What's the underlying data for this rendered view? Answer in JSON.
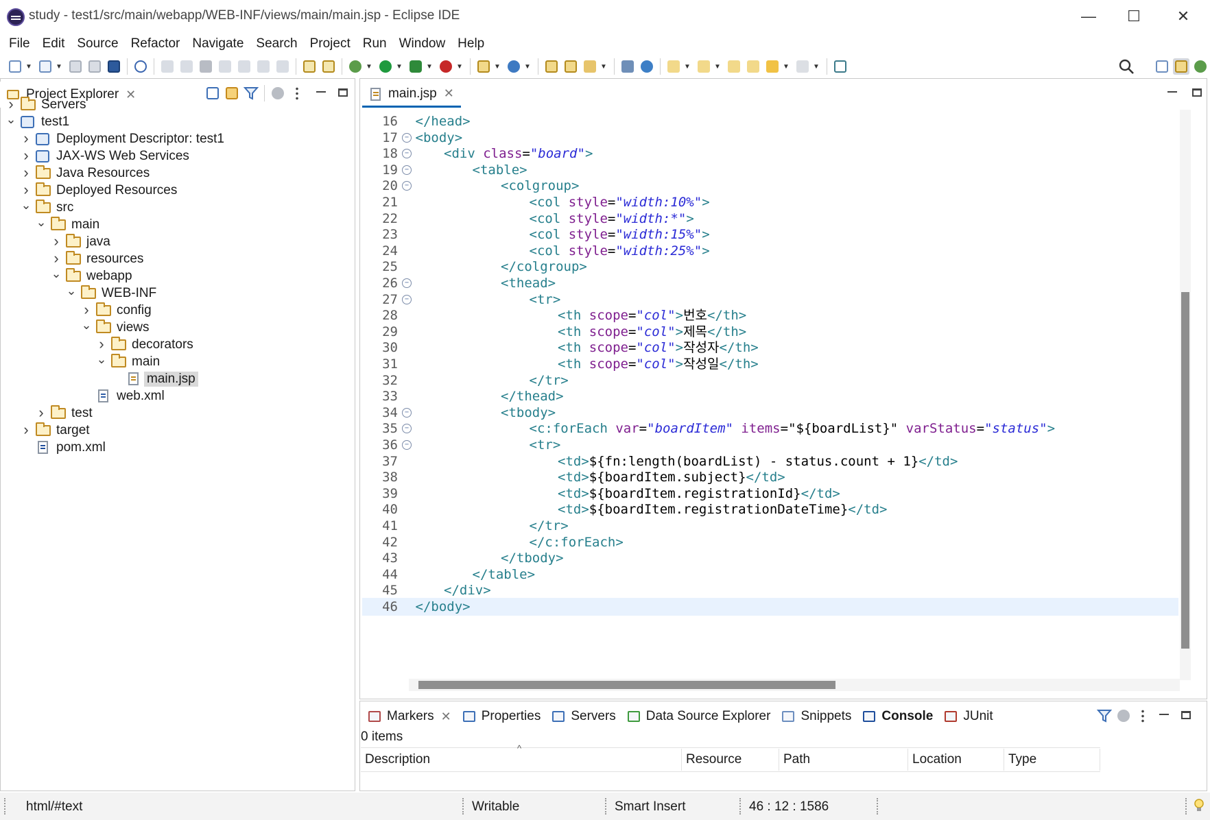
{
  "window": {
    "title": "study - test1/src/main/webapp/WEB-INF/views/main/main.jsp - Eclipse IDE",
    "minimize_glyph": "—",
    "maximize_glyph": "☐",
    "close_glyph": "✕"
  },
  "menu": [
    "File",
    "Edit",
    "Source",
    "Refactor",
    "Navigate",
    "Search",
    "Project",
    "Run",
    "Window",
    "Help"
  ],
  "colors": {
    "accent": "#0063b1",
    "tag": "#267f8c",
    "attribute": "#7f1f8f",
    "string": "#2a2ad6",
    "current_line": "#e8f2fe",
    "folder": "#c08a22"
  },
  "project_explorer": {
    "tab_label": "Project Explorer",
    "close_glyph": "✕",
    "tree": [
      {
        "label": "Servers",
        "depth": 0,
        "expanded": false,
        "icon": "servers-folder-icon"
      },
      {
        "label": "test1",
        "depth": 0,
        "expanded": true,
        "icon": "web-project-icon"
      },
      {
        "label": "Deployment Descriptor: test1",
        "depth": 1,
        "expanded": false,
        "icon": "deployment-descriptor-icon"
      },
      {
        "label": "JAX-WS Web Services",
        "depth": 1,
        "expanded": false,
        "icon": "web-services-icon"
      },
      {
        "label": "Java Resources",
        "depth": 1,
        "expanded": false,
        "icon": "java-resources-icon"
      },
      {
        "label": "Deployed Resources",
        "depth": 1,
        "expanded": false,
        "icon": "deployed-resources-icon"
      },
      {
        "label": "src",
        "depth": 1,
        "expanded": true,
        "icon": "folder-icon"
      },
      {
        "label": "main",
        "depth": 2,
        "expanded": true,
        "icon": "folder-icon"
      },
      {
        "label": "java",
        "depth": 3,
        "expanded": false,
        "icon": "folder-icon"
      },
      {
        "label": "resources",
        "depth": 3,
        "expanded": false,
        "icon": "folder-icon"
      },
      {
        "label": "webapp",
        "depth": 3,
        "expanded": true,
        "icon": "folder-icon"
      },
      {
        "label": "WEB-INF",
        "depth": 4,
        "expanded": true,
        "icon": "folder-icon"
      },
      {
        "label": "config",
        "depth": 5,
        "expanded": false,
        "icon": "folder-icon"
      },
      {
        "label": "views",
        "depth": 5,
        "expanded": true,
        "icon": "folder-icon"
      },
      {
        "label": "decorators",
        "depth": 6,
        "expanded": false,
        "icon": "folder-icon"
      },
      {
        "label": "main",
        "depth": 6,
        "expanded": true,
        "icon": "folder-icon"
      },
      {
        "label": "main.jsp",
        "depth": 7,
        "leaf": true,
        "selected": true,
        "icon": "jsp-file-icon"
      },
      {
        "label": "web.xml",
        "depth": 5,
        "leaf": true,
        "icon": "xml-file-icon"
      },
      {
        "label": "test",
        "depth": 2,
        "expanded": false,
        "icon": "folder-icon"
      },
      {
        "label": "target",
        "depth": 1,
        "expanded": false,
        "icon": "folder-icon"
      },
      {
        "label": "pom.xml",
        "depth": 1,
        "leaf": true,
        "icon": "maven-pom-icon"
      }
    ]
  },
  "editor": {
    "tab_label": "main.jsp",
    "close_glyph": "✕",
    "lines": [
      {
        "n": "16",
        "indent": 1,
        "fold": false,
        "tokens": [
          [
            "tag",
            "</head>"
          ]
        ]
      },
      {
        "n": "17",
        "indent": 1,
        "fold": true,
        "tokens": [
          [
            "tag",
            "<body>"
          ]
        ]
      },
      {
        "n": "18",
        "indent": 2,
        "fold": true,
        "tokens": [
          [
            "tag",
            "<div "
          ],
          [
            "attr",
            "class"
          ],
          [
            "txt",
            "="
          ],
          [
            "str",
            "\"board\""
          ],
          [
            "tag",
            ">"
          ]
        ]
      },
      {
        "n": "19",
        "indent": 3,
        "fold": true,
        "tokens": [
          [
            "tag",
            "<table>"
          ]
        ]
      },
      {
        "n": "20",
        "indent": 4,
        "fold": true,
        "tokens": [
          [
            "tag",
            "<colgroup>"
          ]
        ]
      },
      {
        "n": "21",
        "indent": 5,
        "fold": false,
        "tokens": [
          [
            "tag",
            "<col "
          ],
          [
            "attr",
            "style"
          ],
          [
            "txt",
            "="
          ],
          [
            "str",
            "\"width:10%\""
          ],
          [
            "tag",
            ">"
          ]
        ]
      },
      {
        "n": "22",
        "indent": 5,
        "fold": false,
        "tokens": [
          [
            "tag",
            "<col "
          ],
          [
            "attr",
            "style"
          ],
          [
            "txt",
            "="
          ],
          [
            "str",
            "\"width:*\""
          ],
          [
            "tag",
            ">"
          ]
        ]
      },
      {
        "n": "23",
        "indent": 5,
        "fold": false,
        "tokens": [
          [
            "tag",
            "<col "
          ],
          [
            "attr",
            "style"
          ],
          [
            "txt",
            "="
          ],
          [
            "str",
            "\"width:15%\""
          ],
          [
            "tag",
            ">"
          ]
        ]
      },
      {
        "n": "24",
        "indent": 5,
        "fold": false,
        "tokens": [
          [
            "tag",
            "<col "
          ],
          [
            "attr",
            "style"
          ],
          [
            "txt",
            "="
          ],
          [
            "str",
            "\"width:25%\""
          ],
          [
            "tag",
            ">"
          ]
        ]
      },
      {
        "n": "25",
        "indent": 4,
        "fold": false,
        "tokens": [
          [
            "tag",
            "</colgroup>"
          ]
        ]
      },
      {
        "n": "26",
        "indent": 4,
        "fold": true,
        "tokens": [
          [
            "tag",
            "<thead>"
          ]
        ]
      },
      {
        "n": "27",
        "indent": 5,
        "fold": true,
        "tokens": [
          [
            "tag",
            "<tr>"
          ]
        ]
      },
      {
        "n": "28",
        "indent": 6,
        "fold": false,
        "tokens": [
          [
            "tag",
            "<th "
          ],
          [
            "attr",
            "scope"
          ],
          [
            "txt",
            "="
          ],
          [
            "str",
            "\"col\""
          ],
          [
            "tag",
            ">"
          ],
          [
            "txt",
            "번호"
          ],
          [
            "tag",
            "</th>"
          ]
        ]
      },
      {
        "n": "29",
        "indent": 6,
        "fold": false,
        "tokens": [
          [
            "tag",
            "<th "
          ],
          [
            "attr",
            "scope"
          ],
          [
            "txt",
            "="
          ],
          [
            "str",
            "\"col\""
          ],
          [
            "tag",
            ">"
          ],
          [
            "txt",
            "제목"
          ],
          [
            "tag",
            "</th>"
          ]
        ]
      },
      {
        "n": "30",
        "indent": 6,
        "fold": false,
        "tokens": [
          [
            "tag",
            "<th "
          ],
          [
            "attr",
            "scope"
          ],
          [
            "txt",
            "="
          ],
          [
            "str",
            "\"col\""
          ],
          [
            "tag",
            ">"
          ],
          [
            "txt",
            "작성자"
          ],
          [
            "tag",
            "</th>"
          ]
        ]
      },
      {
        "n": "31",
        "indent": 6,
        "fold": false,
        "tokens": [
          [
            "tag",
            "<th "
          ],
          [
            "attr",
            "scope"
          ],
          [
            "txt",
            "="
          ],
          [
            "str",
            "\"col\""
          ],
          [
            "tag",
            ">"
          ],
          [
            "txt",
            "작성일"
          ],
          [
            "tag",
            "</th>"
          ]
        ]
      },
      {
        "n": "32",
        "indent": 5,
        "fold": false,
        "tokens": [
          [
            "tag",
            "</tr>"
          ]
        ]
      },
      {
        "n": "33",
        "indent": 4,
        "fold": false,
        "tokens": [
          [
            "tag",
            "</thead>"
          ]
        ]
      },
      {
        "n": "34",
        "indent": 4,
        "fold": true,
        "tokens": [
          [
            "tag",
            "<tbody>"
          ]
        ]
      },
      {
        "n": "35",
        "indent": 5,
        "fold": true,
        "tokens": [
          [
            "tag",
            "<c:forEach "
          ],
          [
            "attr",
            "var"
          ],
          [
            "txt",
            "="
          ],
          [
            "str",
            "\"boardItem\""
          ],
          [
            "txt",
            " "
          ],
          [
            "attr",
            "items"
          ],
          [
            "txt",
            "=\"${boardList}\""
          ],
          [
            "txt",
            " "
          ],
          [
            "attr",
            "varStatus"
          ],
          [
            "txt",
            "="
          ],
          [
            "str",
            "\"status\""
          ],
          [
            "tag",
            ">"
          ]
        ]
      },
      {
        "n": "36",
        "indent": 5,
        "fold": true,
        "tokens": [
          [
            "tag",
            "<tr>"
          ]
        ]
      },
      {
        "n": "37",
        "indent": 6,
        "fold": false,
        "tokens": [
          [
            "tag",
            "<td>"
          ],
          [
            "txt",
            "${fn:length(boardList) - status.count + 1}"
          ],
          [
            "tag",
            "</td>"
          ]
        ]
      },
      {
        "n": "38",
        "indent": 6,
        "fold": false,
        "tokens": [
          [
            "tag",
            "<td>"
          ],
          [
            "txt",
            "${boardItem.subject}"
          ],
          [
            "tag",
            "</td>"
          ]
        ]
      },
      {
        "n": "39",
        "indent": 6,
        "fold": false,
        "tokens": [
          [
            "tag",
            "<td>"
          ],
          [
            "txt",
            "${boardItem.registrationId}"
          ],
          [
            "tag",
            "</td>"
          ]
        ]
      },
      {
        "n": "40",
        "indent": 6,
        "fold": false,
        "tokens": [
          [
            "tag",
            "<td>"
          ],
          [
            "txt",
            "${boardItem.registrationDateTime}"
          ],
          [
            "tag",
            "</td>"
          ]
        ]
      },
      {
        "n": "41",
        "indent": 5,
        "fold": false,
        "tokens": [
          [
            "tag",
            "</tr>"
          ]
        ]
      },
      {
        "n": "42",
        "indent": 5,
        "fold": false,
        "tokens": [
          [
            "tag",
            "</c:forEach>"
          ]
        ]
      },
      {
        "n": "43",
        "indent": 4,
        "fold": false,
        "tokens": [
          [
            "tag",
            "</tbody>"
          ]
        ]
      },
      {
        "n": "44",
        "indent": 3,
        "fold": false,
        "tokens": [
          [
            "tag",
            "</table>"
          ]
        ]
      },
      {
        "n": "45",
        "indent": 2,
        "fold": false,
        "tokens": [
          [
            "tag",
            "</div>"
          ]
        ]
      },
      {
        "n": "46",
        "indent": 1,
        "fold": false,
        "current": true,
        "tokens": [
          [
            "tag",
            "</body>"
          ]
        ]
      }
    ]
  },
  "bottom_panel": {
    "tabs": [
      {
        "label": "Markers",
        "icon": "markers-icon",
        "closable": true
      },
      {
        "label": "Properties",
        "icon": "properties-icon"
      },
      {
        "label": "Servers",
        "icon": "servers-icon"
      },
      {
        "label": "Data Source Explorer",
        "icon": "data-source-icon"
      },
      {
        "label": "Snippets",
        "icon": "snippets-icon"
      },
      {
        "label": "Console",
        "icon": "console-icon",
        "bold": true
      },
      {
        "label": "JUnit",
        "icon": "junit-icon"
      }
    ],
    "close_glyph": "✕",
    "item_count": "0 items",
    "columns": [
      "Description",
      "Resource",
      "Path",
      "Location",
      "Type"
    ],
    "sort_glyph": "^"
  },
  "status_bar": {
    "context": "html/#text",
    "writable": "Writable",
    "insert_mode": "Smart Insert",
    "position": "46 : 12 : 1586"
  }
}
